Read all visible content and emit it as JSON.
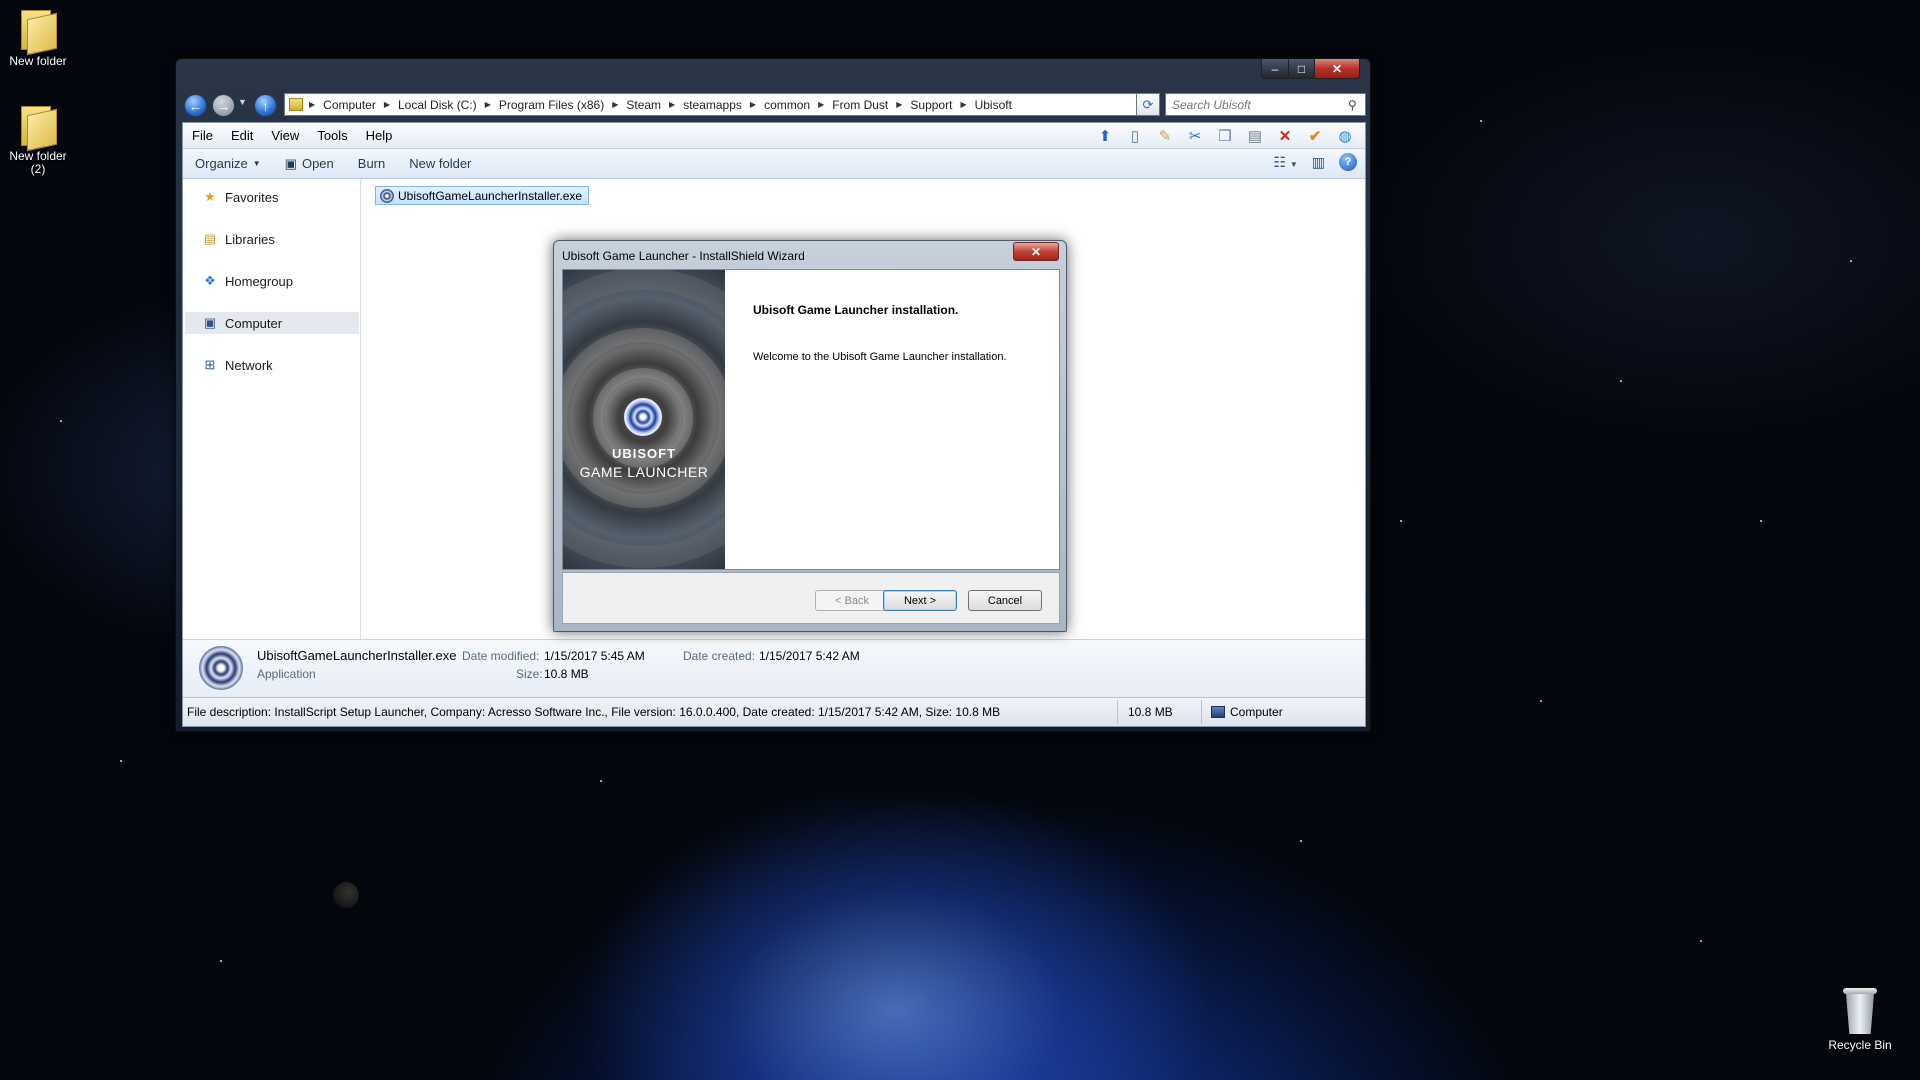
{
  "desktop": {
    "icons": [
      {
        "label": "New folder"
      },
      {
        "label": "New folder\n(2)"
      },
      {
        "label": "Recycle Bin"
      }
    ]
  },
  "explorer": {
    "window_controls": {
      "minimize": "–",
      "maximize": "□",
      "close": "✕"
    },
    "breadcrumbs": [
      "Computer",
      "Local Disk (C:)",
      "Program Files (x86)",
      "Steam",
      "steamapps",
      "common",
      "From Dust",
      "Support",
      "Ubisoft"
    ],
    "search_placeholder": "Search Ubisoft",
    "menu": [
      "File",
      "Edit",
      "View",
      "Tools",
      "Help"
    ],
    "commands": {
      "organize": "Organize",
      "open": "Open",
      "burn": "Burn",
      "new_folder": "New folder"
    },
    "nav": [
      "Favorites",
      "Libraries",
      "Homegroup",
      "Computer",
      "Network"
    ],
    "selected_nav": "Computer",
    "file": {
      "name": "UbisoftGameLauncherInstaller.exe"
    },
    "details": {
      "name": "UbisoftGameLauncherInstaller.exe",
      "type": "Application",
      "date_modified_label": "Date modified:",
      "date_modified": "1/15/2017 5:45 AM",
      "date_created_label": "Date created:",
      "date_created": "1/15/2017 5:42 AM",
      "size_label": "Size:",
      "size": "10.8 MB"
    },
    "status": {
      "description": "File description: InstallScript Setup Launcher, Company: Acresso Software Inc., File version: 16.0.0.400, Date created: 1/15/2017 5:42 AM, Size: 10.8 MB",
      "size": "10.8 MB",
      "location": "Computer"
    }
  },
  "dialog": {
    "title": "Ubisoft Game Launcher - InstallShield Wizard",
    "close": "✕",
    "banner_brand": "UBISOFT",
    "banner_sub": "GAME LAUNCHER",
    "heading": "Ubisoft Game Launcher installation.",
    "welcome": "Welcome to the Ubisoft Game Launcher installation.",
    "buttons": {
      "back": "< Back",
      "next": "Next >",
      "cancel": "Cancel"
    }
  },
  "colors": {
    "selection": "#cce8ff",
    "accent": "#3c7fb1",
    "close_red": "#c14334"
  }
}
